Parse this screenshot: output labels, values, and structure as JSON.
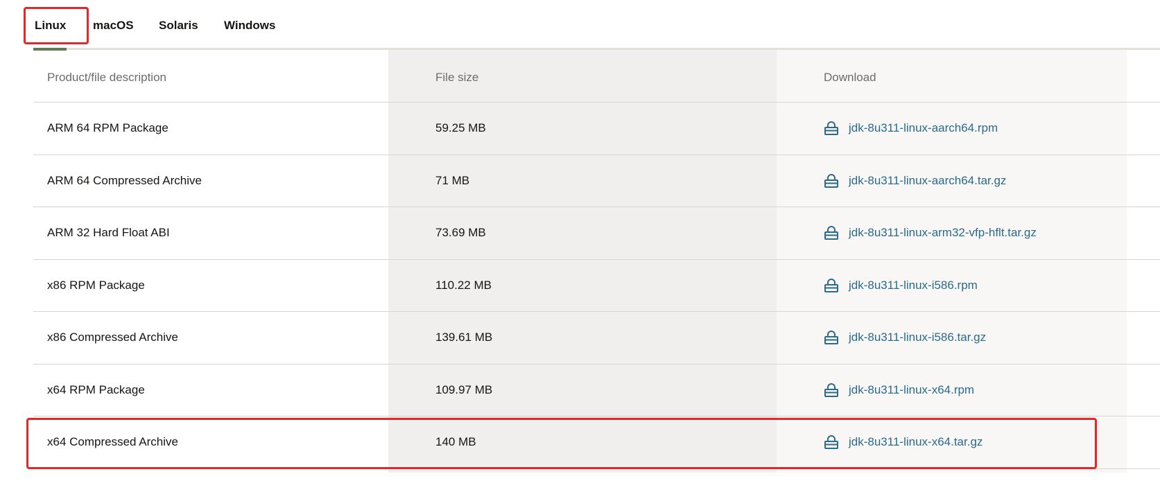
{
  "tabs": [
    {
      "label": "Linux",
      "active": true
    },
    {
      "label": "macOS",
      "active": false
    },
    {
      "label": "Solaris",
      "active": false
    },
    {
      "label": "Windows",
      "active": false
    }
  ],
  "table": {
    "headers": [
      "Product/file description",
      "File size",
      "Download"
    ],
    "rows": [
      {
        "description": "ARM 64 RPM Package",
        "size": "59.25 MB",
        "file": "jdk-8u311-linux-aarch64.rpm"
      },
      {
        "description": "ARM 64 Compressed Archive",
        "size": "71 MB",
        "file": "jdk-8u311-linux-aarch64.tar.gz"
      },
      {
        "description": "ARM 32 Hard Float ABI",
        "size": "73.69 MB",
        "file": "jdk-8u311-linux-arm32-vfp-hflt.tar.gz"
      },
      {
        "description": "x86 RPM Package",
        "size": "110.22 MB",
        "file": "jdk-8u311-linux-i586.rpm"
      },
      {
        "description": "x86 Compressed Archive",
        "size": "139.61 MB",
        "file": "jdk-8u311-linux-i586.tar.gz"
      },
      {
        "description": "x64 RPM Package",
        "size": "109.97 MB",
        "file": "jdk-8u311-linux-x64.rpm"
      },
      {
        "description": "x64 Compressed Archive",
        "size": "140 MB",
        "file": "jdk-8u311-linux-x64.tar.gz"
      }
    ]
  },
  "icons": {
    "download": "lock-icon"
  },
  "colors": {
    "link": "#2a6a8b",
    "active_tab_underline": "#5f7d4f",
    "highlight": "#e8262a"
  }
}
